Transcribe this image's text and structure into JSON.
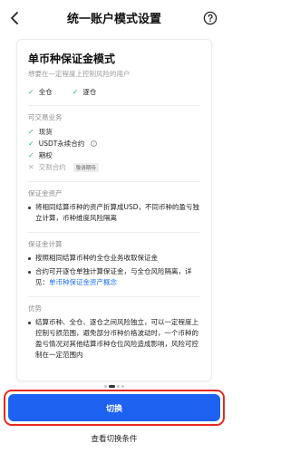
{
  "header": {
    "title": "统一账户模式设置"
  },
  "card": {
    "mode_title": "单币种保证金模式",
    "mode_subtitle": "想要在一定程度上控制风险的用户",
    "margin_options": [
      "全仓",
      "逐仓"
    ],
    "tradable_label": "可交易业务",
    "tradable": [
      {
        "label": "现货",
        "enabled": true
      },
      {
        "label": "USDT永续合约",
        "enabled": true,
        "info": true
      },
      {
        "label": "期权",
        "enabled": true
      },
      {
        "label": "交割合约",
        "enabled": false,
        "tag": "敬请期待"
      }
    ],
    "margin_assets_label": "保证金资产",
    "margin_assets": [
      "将相同结算币种的资产折算成USD，不同币种的盈亏独立计算，币种维度风险隔离"
    ],
    "margin_calc_label": "保证金计算",
    "margin_calc": [
      {
        "text": "按照相同结算币种的全仓业务收取保证金"
      },
      {
        "text": "合约可开逐仓单独计算保证金，与全仓风险隔离，详见：",
        "link": "单币种保证金资产概念"
      }
    ],
    "advantages_label": "优势",
    "advantages": [
      "结算币种、全仓、逐仓之间风险独立，可以一定程度上控制亏损范围，避免部分币种价格波动时，一个币种的盈亏情况对其他结算币种仓位风险造成影响，风险可控制在一定范围内"
    ]
  },
  "primary_button": {
    "label": "切换"
  },
  "secondary_link": {
    "label": "查看切换条件"
  },
  "colors": {
    "accent": "#1d62f0",
    "check": "#2bb36a",
    "highlight": "#e8281f"
  }
}
